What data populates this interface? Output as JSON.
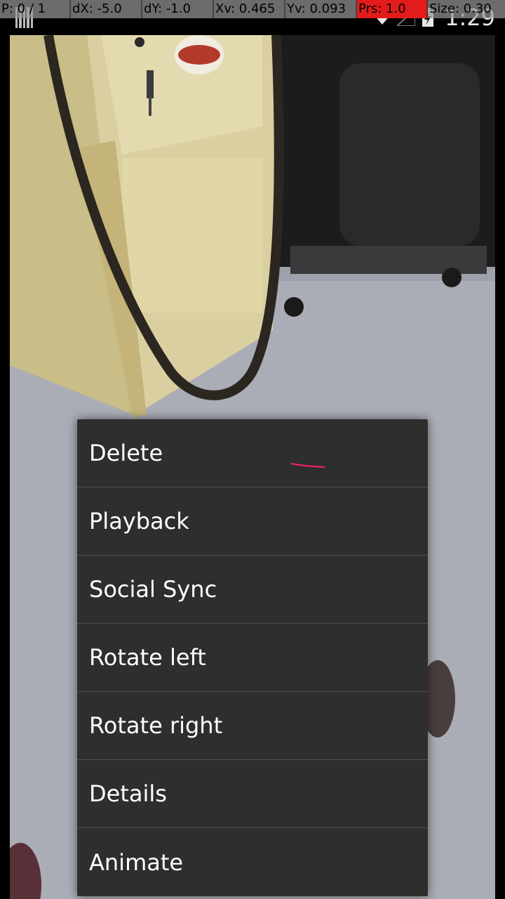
{
  "status_bar": {
    "time": "1:29",
    "left_icon": "barcode-notification-icon",
    "wifi_icon": "wifi-icon",
    "signal_icon": "cell-signal-icon",
    "battery_icon": "battery-charging-icon"
  },
  "pointer_info": {
    "pointer": "P: 0 / 1",
    "dx": "dX: -5.0",
    "dy": "dY: -1.0",
    "xv": "Xv: 0.465",
    "yv": "Yv: 0.093",
    "pressure": "Prs: 1.0",
    "size": "Size: 0.30",
    "pressure_color": "#e31b1b"
  },
  "context_menu": {
    "items": [
      {
        "label": "Delete"
      },
      {
        "label": "Playback"
      },
      {
        "label": "Social Sync"
      },
      {
        "label": "Rotate left"
      },
      {
        "label": "Rotate right"
      },
      {
        "label": "Details"
      },
      {
        "label": "Animate"
      }
    ]
  },
  "colors": {
    "menu_background": "#2e2e2e",
    "menu_divider": "#4e4e4e",
    "menu_text": "#ffffff",
    "touch_trace": "#ff2266"
  }
}
